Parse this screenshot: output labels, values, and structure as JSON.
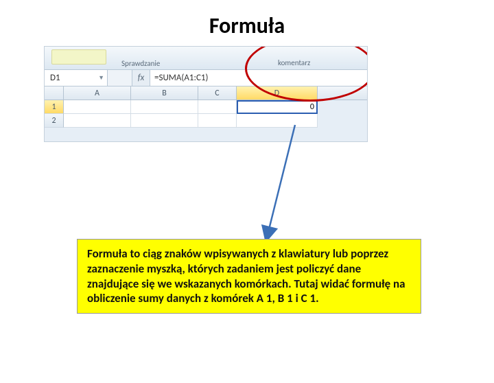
{
  "title": "Formuła",
  "ribbon": {
    "group_label": "Sprawdzanie",
    "comment_label": "komentarz"
  },
  "namebox": {
    "value": "D1"
  },
  "fx": {
    "label": "fx",
    "formula": "=SUMA(A1:C1)"
  },
  "columns": {
    "A": "A",
    "B": "B",
    "C": "C",
    "D": "D"
  },
  "rows": {
    "r1": "1",
    "r2": "2"
  },
  "cells": {
    "D1": "0"
  },
  "explanation": "Formuła to ciąg znaków wpisywanych z klawiatury lub poprzez zaznaczenie myszką, których zadaniem jest policzyć dane znajdujące się we wskazanych komórkach. Tutaj widać formułę na obliczenie sumy danych z komórek A 1, B 1 i C 1."
}
